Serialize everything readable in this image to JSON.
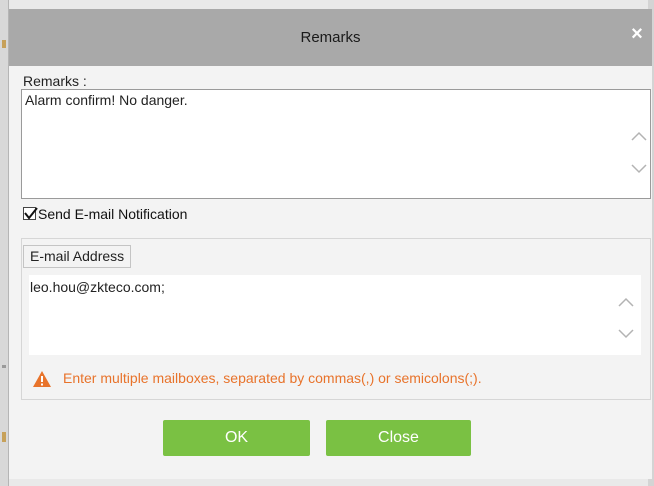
{
  "dialog": {
    "title": "Remarks",
    "close_glyph": "×"
  },
  "remarks": {
    "label": "Remarks :",
    "value": "Alarm confirm! No danger."
  },
  "notification": {
    "checked": true,
    "label": "Send E-mail Notification"
  },
  "email": {
    "legend": "E-mail Address",
    "value": "leo.hou@zkteco.com;",
    "hint": "Enter multiple mailboxes, separated by commas(,) or semicolons(;)."
  },
  "buttons": {
    "ok": "OK",
    "close": "Close"
  },
  "colors": {
    "titlebar": "#a9a9a9",
    "button": "#7ac143",
    "hint": "#e8732b"
  },
  "icons": {
    "warning": "warning-icon",
    "scroll_up": "chevron-up-icon",
    "scroll_down": "chevron-down-icon",
    "check": "check-icon"
  }
}
